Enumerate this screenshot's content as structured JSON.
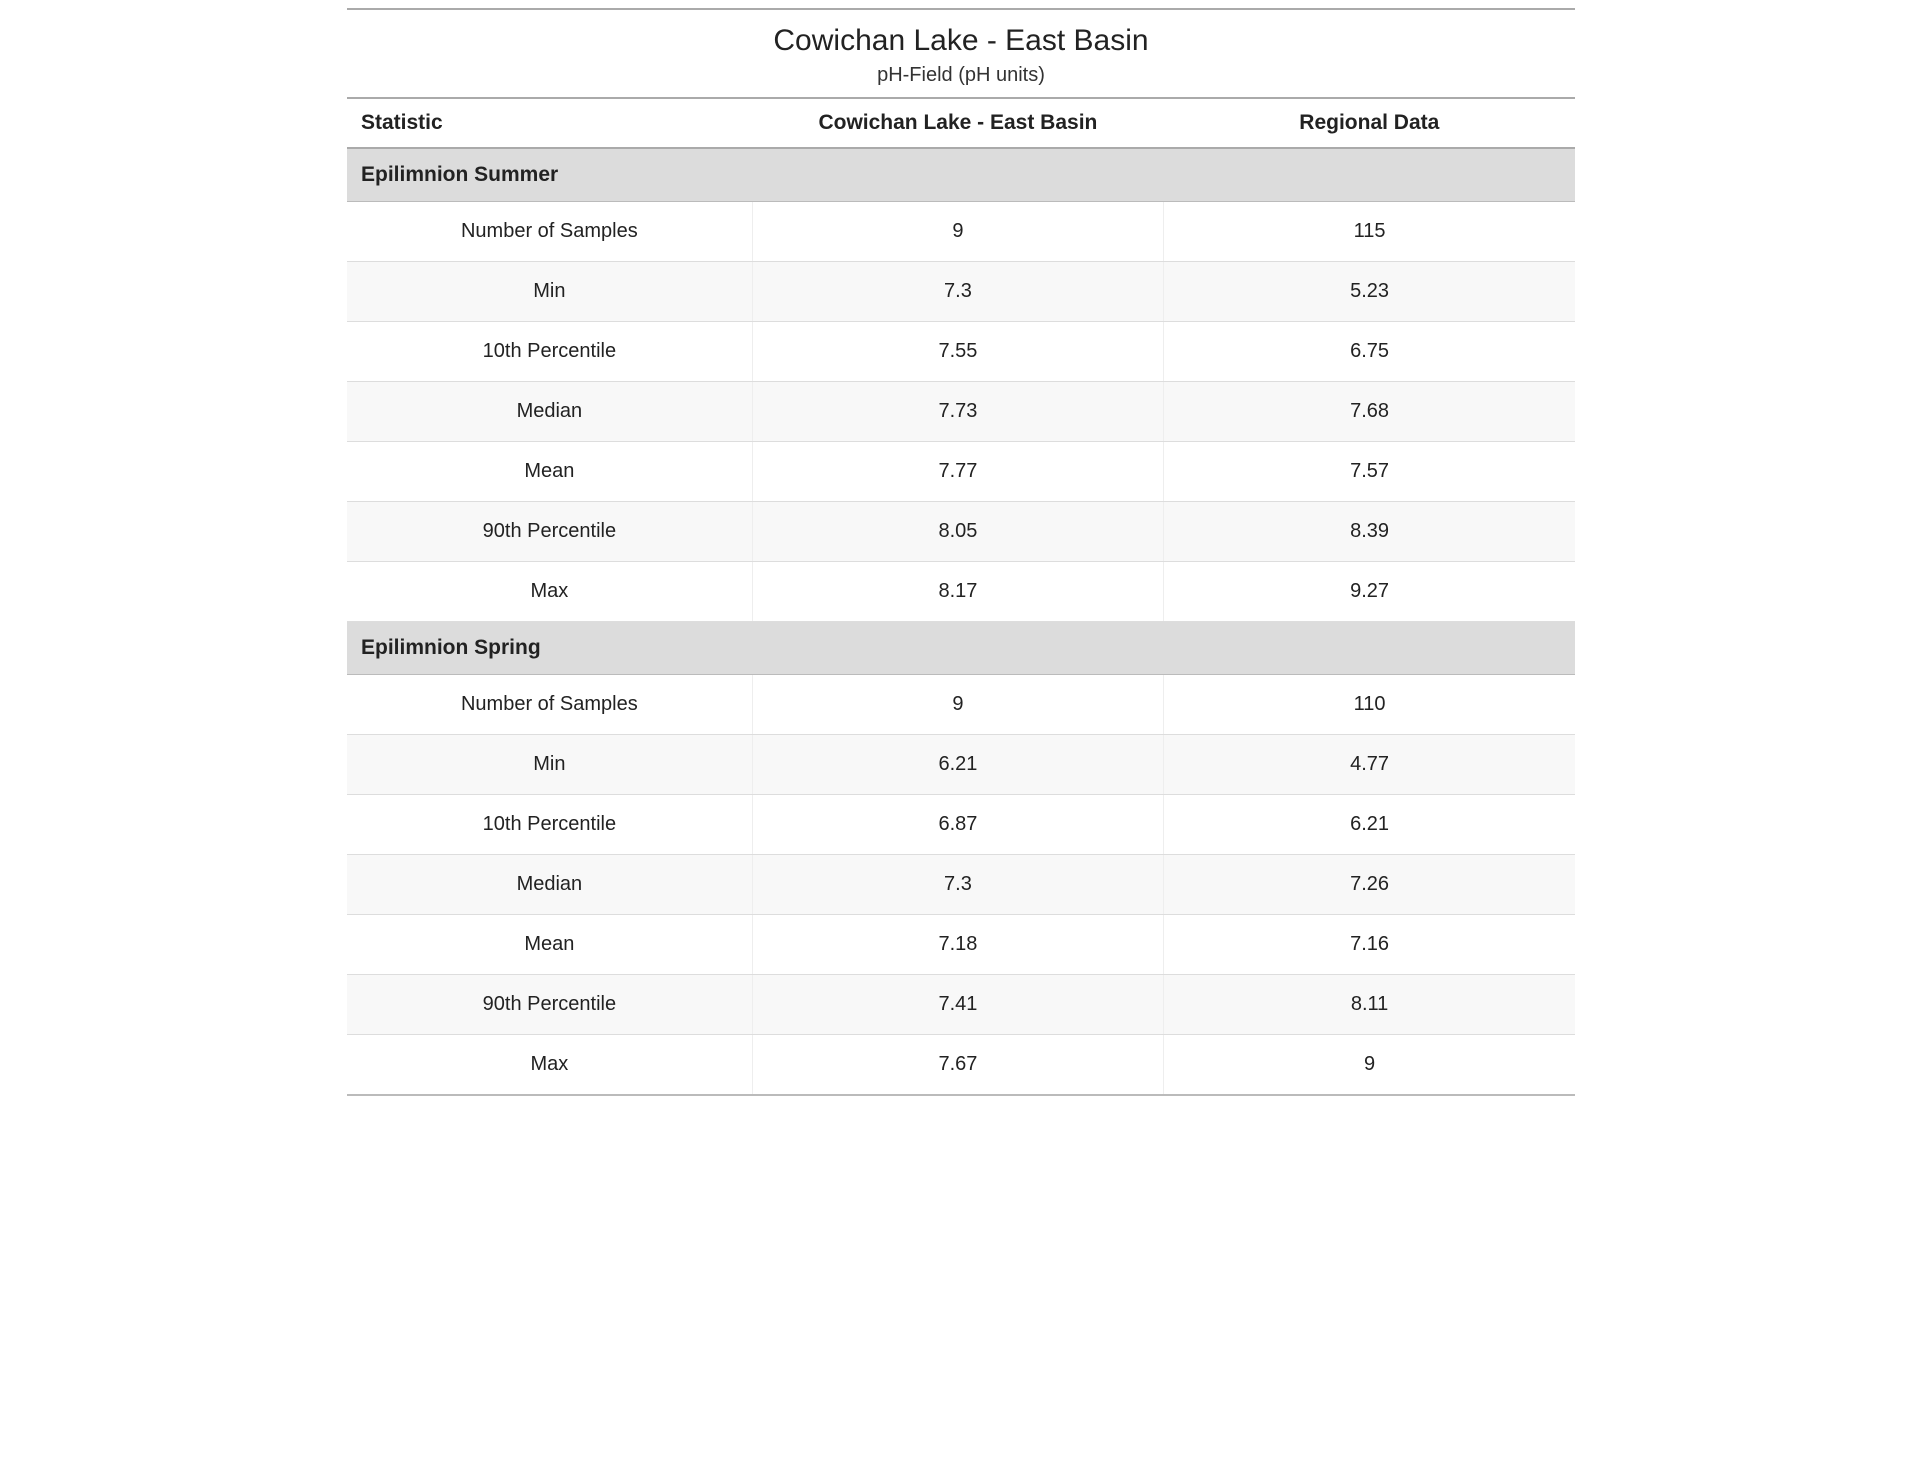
{
  "header": {
    "title": "Cowichan Lake - East Basin",
    "subtitle": "pH-Field (pH units)"
  },
  "columns": {
    "statistic": "Statistic",
    "site": "Cowichan Lake - East Basin",
    "regional": "Regional Data"
  },
  "sections": [
    {
      "name": "Epilimnion Summer",
      "rows": [
        {
          "statistic": "Number of Samples",
          "site": "9",
          "regional": "115"
        },
        {
          "statistic": "Min",
          "site": "7.3",
          "regional": "5.23"
        },
        {
          "statistic": "10th Percentile",
          "site": "7.55",
          "regional": "6.75"
        },
        {
          "statistic": "Median",
          "site": "7.73",
          "regional": "7.68"
        },
        {
          "statistic": "Mean",
          "site": "7.77",
          "regional": "7.57"
        },
        {
          "statistic": "90th Percentile",
          "site": "8.05",
          "regional": "8.39"
        },
        {
          "statistic": "Max",
          "site": "8.17",
          "regional": "9.27"
        }
      ]
    },
    {
      "name": "Epilimnion Spring",
      "rows": [
        {
          "statistic": "Number of Samples",
          "site": "9",
          "regional": "110"
        },
        {
          "statistic": "Min",
          "site": "6.21",
          "regional": "4.77"
        },
        {
          "statistic": "10th Percentile",
          "site": "6.87",
          "regional": "6.21"
        },
        {
          "statistic": "Median",
          "site": "7.3",
          "regional": "7.26"
        },
        {
          "statistic": "Mean",
          "site": "7.18",
          "regional": "7.16"
        },
        {
          "statistic": "90th Percentile",
          "site": "7.41",
          "regional": "8.11"
        },
        {
          "statistic": "Max",
          "site": "7.67",
          "regional": "9"
        }
      ]
    }
  ]
}
